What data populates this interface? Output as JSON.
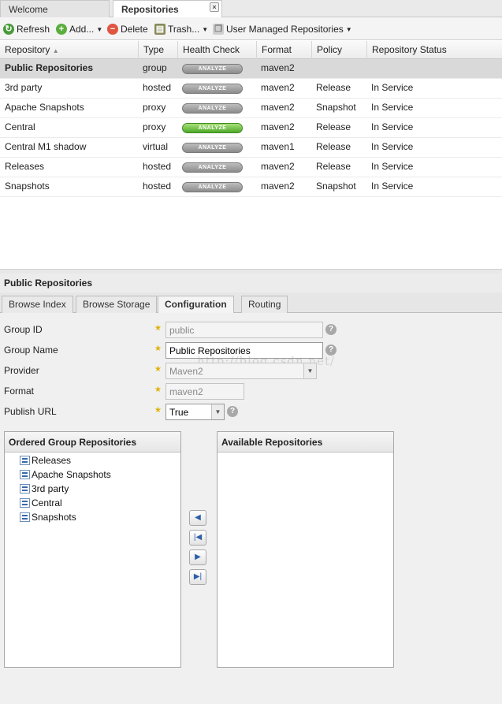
{
  "tabs": [
    {
      "label": "Welcome"
    },
    {
      "label": "Repositories"
    }
  ],
  "toolbar": {
    "refresh": "Refresh",
    "add": "Add...",
    "delete": "Delete",
    "trash": "Trash...",
    "user_managed": "User Managed Repositories"
  },
  "grid": {
    "columns": [
      "Repository",
      "Type",
      "Health Check",
      "Format",
      "Policy",
      "Repository Status"
    ],
    "rows": [
      {
        "name": "Public Repositories",
        "type": "group",
        "health": "ANALYZE",
        "format": "maven2",
        "policy": "",
        "status": ""
      },
      {
        "name": "3rd party",
        "type": "hosted",
        "health": "ANALYZE",
        "format": "maven2",
        "policy": "Release",
        "status": "In Service"
      },
      {
        "name": "Apache Snapshots",
        "type": "proxy",
        "health": "ANALYZE",
        "format": "maven2",
        "policy": "Snapshot",
        "status": "In Service"
      },
      {
        "name": "Central",
        "type": "proxy",
        "health": "ANALYZE",
        "format": "maven2",
        "policy": "Release",
        "status": "In Service"
      },
      {
        "name": "Central M1 shadow",
        "type": "virtual",
        "health": "ANALYZE",
        "format": "maven1",
        "policy": "Release",
        "status": "In Service"
      },
      {
        "name": "Releases",
        "type": "hosted",
        "health": "ANALYZE",
        "format": "maven2",
        "policy": "Release",
        "status": "In Service"
      },
      {
        "name": "Snapshots",
        "type": "hosted",
        "health": "ANALYZE",
        "format": "maven2",
        "policy": "Snapshot",
        "status": "In Service"
      }
    ]
  },
  "detail": {
    "title": "Public Repositories",
    "tabs": [
      "Browse Index",
      "Browse Storage",
      "Configuration",
      "Routing"
    ],
    "form": {
      "group_id_label": "Group ID",
      "group_id_value": "public",
      "group_name_label": "Group Name",
      "group_name_value": "Public Repositories",
      "provider_label": "Provider",
      "provider_value": "Maven2",
      "format_label": "Format",
      "format_value": "maven2",
      "publish_url_label": "Publish URL",
      "publish_url_value": "True"
    },
    "watermark": "http://blog.csdn.net/",
    "ordered_title": "Ordered Group Repositories",
    "ordered_items": [
      "Releases",
      "Apache Snapshots",
      "3rd party",
      "Central",
      "Snapshots"
    ],
    "available_title": "Available Repositories"
  },
  "colors": {
    "selected_row": "#d9d9d9",
    "analyze_gray": "#9a9a9a",
    "analyze_green": "#5cb833",
    "required_star": "#e0b000"
  }
}
